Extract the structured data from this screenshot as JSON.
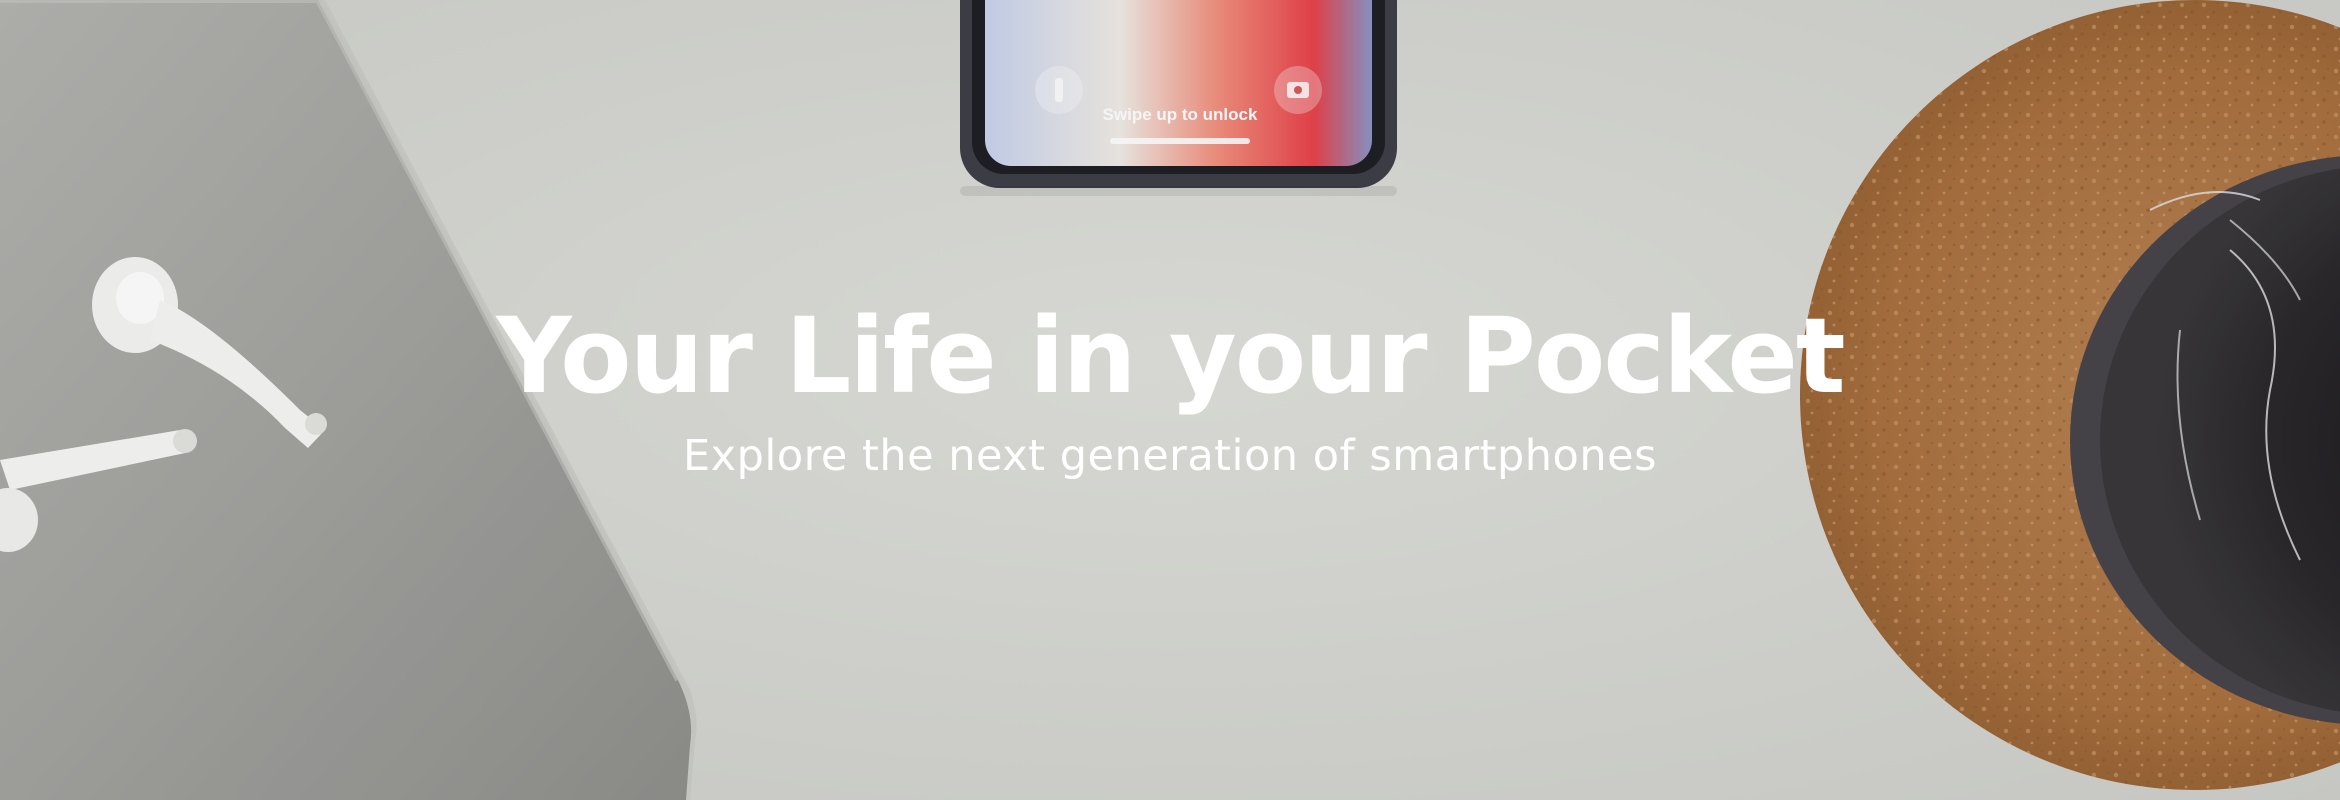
{
  "hero": {
    "title": "Your Life in your Pocket",
    "subtitle": "Explore the next generation of smartphones",
    "phone_lock_hint": "Swipe up to unlock"
  },
  "colors": {
    "background": "#d7d8d3",
    "text": "#ffffff",
    "laptop": "#9c9c99",
    "cork": "#b07a4c",
    "mug": "#2b292c"
  },
  "icons": {
    "phone_left": "flashlight-icon",
    "phone_right": "camera-icon"
  }
}
